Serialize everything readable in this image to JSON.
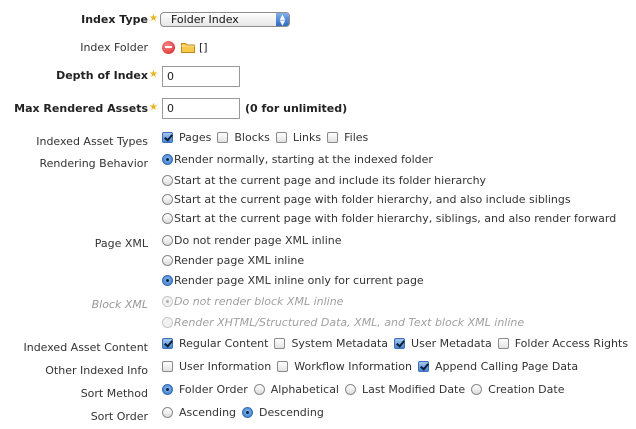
{
  "index_type": {
    "label": "Index Type",
    "value": "Folder Index"
  },
  "index_folder": {
    "label": "Index Folder",
    "value": "[]"
  },
  "depth_of_index": {
    "label": "Depth of Index",
    "value": "0"
  },
  "max_rendered_assets": {
    "label": "Max Rendered Assets",
    "value": "0",
    "note": "(0 for unlimited)"
  },
  "indexed_asset_types": {
    "label": "Indexed Asset Types",
    "options": [
      {
        "label": "Pages",
        "checked": true
      },
      {
        "label": "Blocks",
        "checked": false
      },
      {
        "label": "Links",
        "checked": false
      },
      {
        "label": "Files",
        "checked": false
      }
    ]
  },
  "rendering_behavior": {
    "label": "Rendering Behavior",
    "options": [
      {
        "label": "Render normally, starting at the indexed folder",
        "selected": true
      },
      {
        "label": "Start at the current page and include its folder hierarchy",
        "selected": false
      },
      {
        "label": "Start at the current page with folder hierarchy, and also include siblings",
        "selected": false
      },
      {
        "label": "Start at the current page with folder hierarchy, siblings, and also render forward",
        "selected": false
      }
    ]
  },
  "page_xml": {
    "label": "Page XML",
    "options": [
      {
        "label": "Do not render page XML inline",
        "selected": false
      },
      {
        "label": "Render page XML inline",
        "selected": false
      },
      {
        "label": "Render page XML inline only for current page",
        "selected": true
      }
    ]
  },
  "block_xml": {
    "label": "Block XML",
    "options": [
      {
        "label": "Do not render block XML inline",
        "selected": true
      },
      {
        "label": "Render XHTML/Structured Data, XML, and Text block XML inline",
        "selected": false
      }
    ]
  },
  "indexed_asset_content": {
    "label": "Indexed Asset Content",
    "options": [
      {
        "label": "Regular Content",
        "checked": true
      },
      {
        "label": "System Metadata",
        "checked": false
      },
      {
        "label": "User Metadata",
        "checked": true
      },
      {
        "label": "Folder Access Rights",
        "checked": false
      }
    ]
  },
  "other_indexed_info": {
    "label": "Other Indexed Info",
    "options": [
      {
        "label": "User Information",
        "checked": false
      },
      {
        "label": "Workflow Information",
        "checked": false
      },
      {
        "label": "Append Calling Page Data",
        "checked": true
      }
    ]
  },
  "sort_method": {
    "label": "Sort Method",
    "options": [
      {
        "label": "Folder Order",
        "selected": true
      },
      {
        "label": "Alphabetical",
        "selected": false
      },
      {
        "label": "Last Modified Date",
        "selected": false
      },
      {
        "label": "Creation Date",
        "selected": false
      }
    ]
  },
  "sort_order": {
    "label": "Sort Order",
    "options": [
      {
        "label": "Ascending",
        "selected": false
      },
      {
        "label": "Descending",
        "selected": true
      }
    ]
  },
  "colors": {
    "required_star": "#e8b41d",
    "accent": "#4f8fd9"
  }
}
